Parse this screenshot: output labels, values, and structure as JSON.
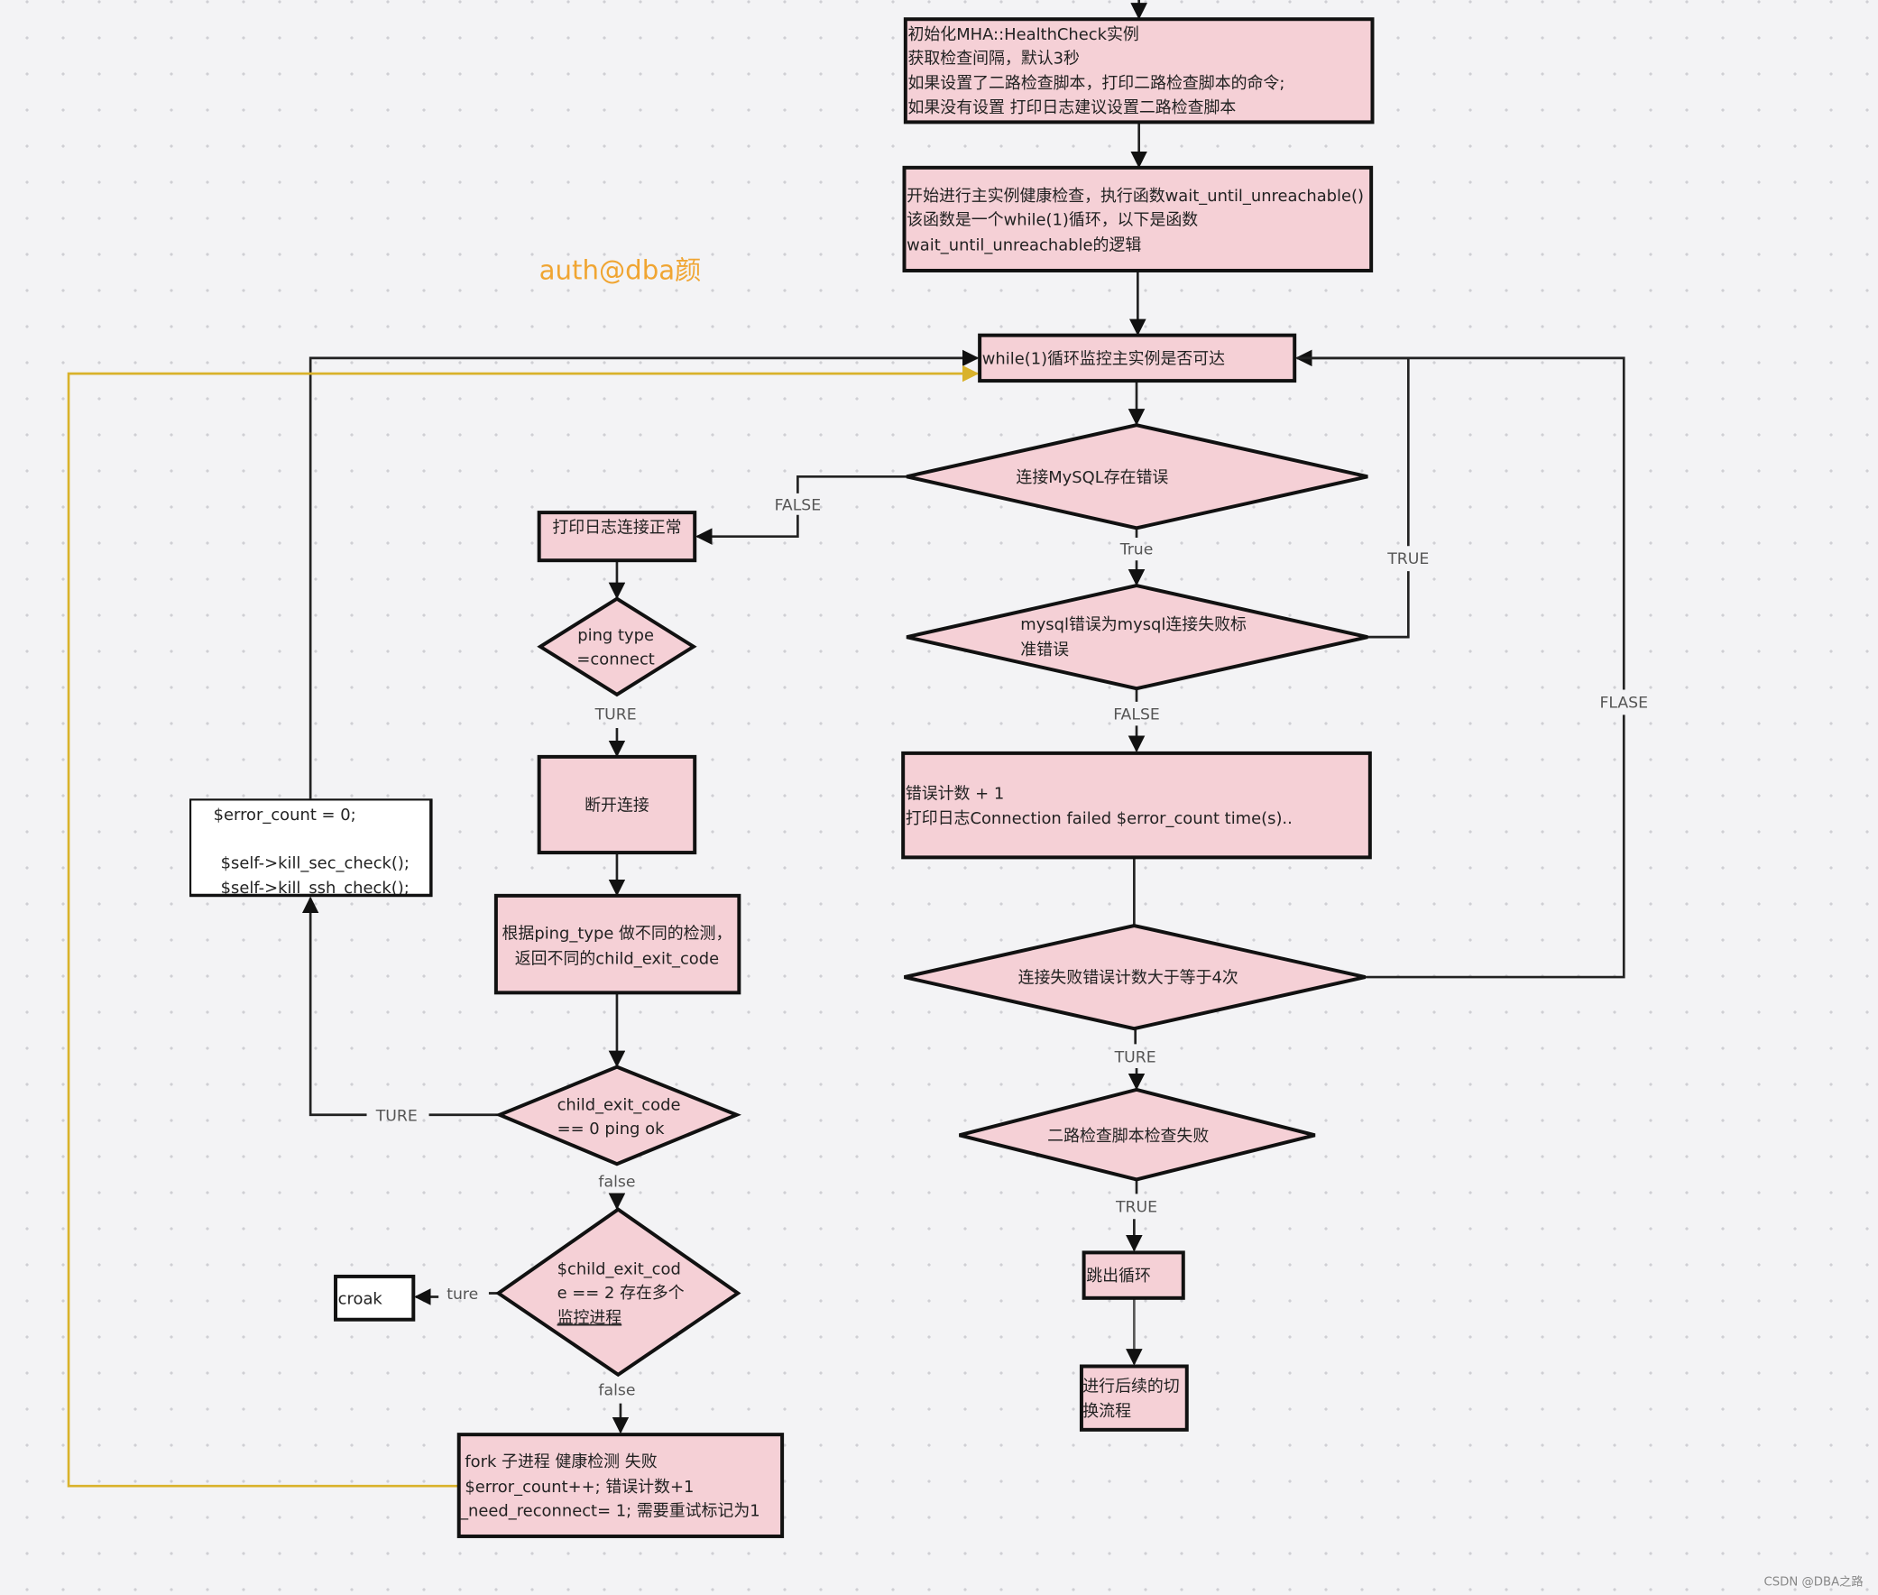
{
  "watermark": "auth@dba颜",
  "footer_credit": "CSDN @DBA之路",
  "colors": {
    "node_fill": "#f5d0d6",
    "node_stroke": "#111111",
    "loop_line": "#d9b22b",
    "watermark": "#f0a532",
    "background": "#f3f3f5"
  },
  "nodes": {
    "init": [
      "初始化MHA::HealthCheck实例",
      "获取检查间隔，默认3秒",
      "如果设置了二路检查脚本，打印二路检查脚本的命令;",
      "如果没有设置 打印日志建议设置二路检查脚本"
    ],
    "start_check": [
      "开始进行主实例健康检查，执行函数wait_until_unreachable()",
      "该函数是一个while(1)循环，以下是函数",
      "wait_until_unreachable的逻辑"
    ],
    "while_loop": "while(1)循环监控主实例是否可达",
    "mysql_error": "连接MySQL存在错误",
    "log_ok": "打印日志连接正常",
    "ping_type": [
      "ping type",
      "=connect"
    ],
    "disconnect": "断开连接",
    "check_by_type": [
      "根据ping_type 做不同的检测，",
      "返回不同的child_exit_code"
    ],
    "exit_code_zero": [
      "child_exit_code",
      "== 0 ping ok"
    ],
    "reset": [
      "$error_count = 0;",
      "$self->kill_sec_check();",
      "$self->kill_ssh_check();"
    ],
    "exit_code_two": [
      "$child_exit_cod",
      "e == 2 存在多个",
      "监控进程"
    ],
    "croak": "croak",
    "fork_fail": [
      "fork 子进程 健康检测 失败",
      "$error_count++;  错误计数+1",
      "_need_reconnect= 1; 需要重试标记为1"
    ],
    "std_error": [
      "mysql错误为mysql连接失败标",
      "准错误"
    ],
    "count_inc": [
      "错误计数 + 1",
      "打印日志Connection failed $error_count time(s).."
    ],
    "fail_ge4": "连接失败错误计数大于等于4次",
    "secondary_fail": "二路检查脚本检查失败",
    "break_loop": "跳出循环",
    "failover": [
      "进行后续的切",
      "换流程"
    ]
  },
  "edge_labels": {
    "mysql_false": "FALSE",
    "mysql_true": "True",
    "std_true": "TRUE",
    "std_false": "FALSE",
    "ge4_false": "FLASE",
    "ge4_true": "TURE",
    "secondary_true": "TRUE",
    "ping_true": "TURE",
    "zero_true": "TURE",
    "zero_false": "false",
    "two_true": "ture",
    "two_false": "false"
  }
}
